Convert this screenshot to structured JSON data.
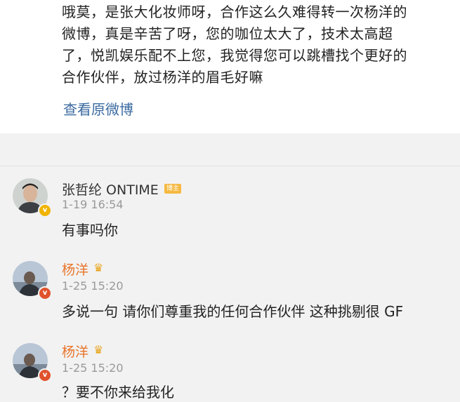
{
  "quoted_post": {
    "text": "哦莫，是张大化妆师呀，合作这么久难得转一次杨洋的\n微博，真是辛苦了呀，您的咖位太大了，技术太高超\n了，悦凯娱乐配不上您，我觉得您可以跳槽找个更好的\n合作伙伴，放过杨洋的眉毛好嘛",
    "view_original_label": "查看原微博"
  },
  "comments": [
    {
      "username": "张哲纶 ONTIME",
      "badge": "博主",
      "time": "1-19 16:54",
      "text": "有事吗你",
      "verified_color": "#f0b400"
    },
    {
      "username": "杨洋",
      "crown_icon": "crown-icon",
      "time": "1-25 15:20",
      "text": "多说一句 请你们尊重我的任何合作伙伴 这种挑剔很 GF",
      "verified_color": "#e0522c"
    },
    {
      "username": "杨洋",
      "crown_icon": "crown-icon",
      "time": "1-25 15:20",
      "text": "？要不你来给我化",
      "verified_color": "#e0522c"
    }
  ],
  "colors": {
    "link": "#3b6aa0",
    "username_orange": "#e8762d",
    "time_gray": "#999999",
    "background": "#f2f2f2"
  }
}
